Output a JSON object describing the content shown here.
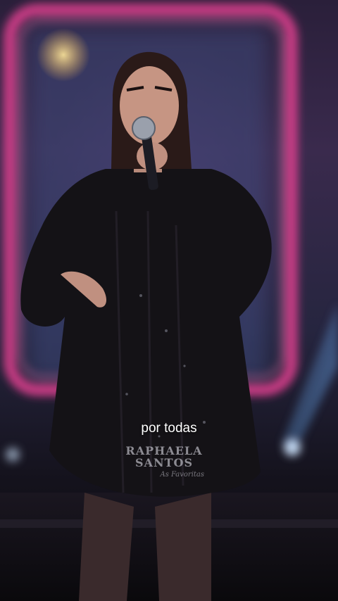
{
  "caption": "por todas",
  "watermark": {
    "line1": "RAPHAELA",
    "line2": "SANTOS",
    "tagline": "As Favoritas"
  },
  "colors": {
    "neon_frame": "#e0408f",
    "spotlight": "#6fb4ff",
    "outfit": "#141216"
  }
}
